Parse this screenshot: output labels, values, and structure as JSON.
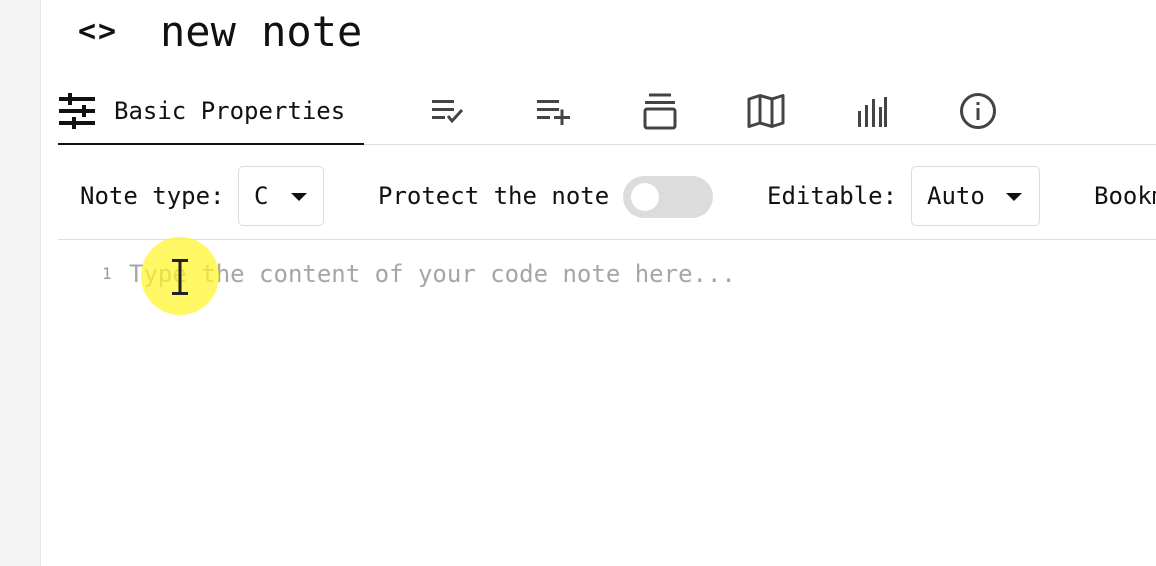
{
  "note": {
    "type_icon": "code-icon",
    "title": "new note"
  },
  "tabs": [
    {
      "icon": "sliders-icon",
      "label": "Basic Properties",
      "active": true
    },
    {
      "icon": "checklist-icon",
      "label": ""
    },
    {
      "icon": "list-add-icon",
      "label": ""
    },
    {
      "icon": "stack-icon",
      "label": ""
    },
    {
      "icon": "map-icon",
      "label": ""
    },
    {
      "icon": "bar-chart-icon",
      "label": ""
    },
    {
      "icon": "info-icon",
      "label": ""
    }
  ],
  "properties": {
    "note_type_label": "Note type:",
    "note_type_value": "C",
    "protect_label": "Protect the note",
    "protect_enabled": false,
    "editable_label": "Editable:",
    "editable_value": "Auto",
    "bookmark_label": "Bookm"
  },
  "editor": {
    "line_number": "1",
    "placeholder": "Type the content of your code note here..."
  },
  "colors": {
    "highlight": "#fff528",
    "toggle_off": "#dcdcdc",
    "placeholder": "#a6a6a6"
  }
}
